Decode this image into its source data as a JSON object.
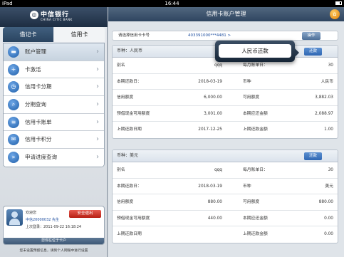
{
  "status": {
    "device": "iPad",
    "time": "16:44"
  },
  "brand": {
    "name_cn": "中信银行",
    "name_en": "CHINA CITIC BANK"
  },
  "tabs": [
    {
      "label": "借记卡"
    },
    {
      "label": "信用卡"
    }
  ],
  "menu": [
    {
      "label": "账户管理",
      "icon": "card-icon"
    },
    {
      "label": "卡激活",
      "icon": "activate-icon"
    },
    {
      "label": "信用卡分期",
      "icon": "clock-icon"
    },
    {
      "label": "分期查询",
      "icon": "search-icon"
    },
    {
      "label": "信用卡账单",
      "icon": "bill-icon"
    },
    {
      "label": "信用卡积分",
      "icon": "points-icon"
    },
    {
      "label": "申请进度查询",
      "icon": "progress-icon"
    }
  ],
  "user": {
    "welcome": "欢迎您",
    "name": "中信20000032 先生",
    "last_login": "上次登录：2011-09-22 16:18:24",
    "logout": "安全退出",
    "bar": "您现在位于卡户",
    "note": "您未设置预留信息，请到个人网银中进行设置"
  },
  "header": {
    "title": "信用卡账户管理"
  },
  "selector": {
    "label": "请选择信用卡卡号",
    "value": "403391000***4481 >",
    "op": "操作"
  },
  "popover": {
    "label": "人民币还款"
  },
  "sections": [
    {
      "currency": "币种：人民币",
      "pay": "还款",
      "rows": [
        {
          "l1": "别名",
          "v1": "qqq",
          "l2": "每月账单日：",
          "v2": "30"
        },
        {
          "l1": "本期还款日：",
          "v1": "2018-03-19",
          "l2": "币种",
          "v2": "人民币"
        },
        {
          "l1": "信用额度",
          "v1": "6,000.00",
          "l2": "可用额度",
          "v2": "3,882.03"
        },
        {
          "l1": "预借现金可用额度",
          "v1": "3,001.00",
          "l2": "本期应还金额",
          "v2": "2,088.97"
        },
        {
          "l1": "上期还款日期",
          "v1": "2017-12-25",
          "l2": "上期还款金额",
          "v2": "1.00"
        }
      ]
    },
    {
      "currency": "币种：美元",
      "pay": "还款",
      "rows": [
        {
          "l1": "别名",
          "v1": "qqq",
          "l2": "每月账单日：",
          "v2": "30"
        },
        {
          "l1": "本期还款日：",
          "v1": "2018-03-19",
          "l2": "币种",
          "v2": "美元"
        },
        {
          "l1": "信用额度",
          "v1": "880.00",
          "l2": "可用额度",
          "v2": "880.00"
        },
        {
          "l1": "预借现金可用额度",
          "v1": "440.00",
          "l2": "本期应还金额",
          "v2": "0.00"
        },
        {
          "l1": "上期还款日期",
          "v1": "",
          "l2": "上期还款金额",
          "v2": "0.00"
        }
      ]
    }
  ],
  "colors": {
    "nav": "#2f4560",
    "accent": "#2f67b3",
    "logout": "#b71f14",
    "home": "#e07b00"
  }
}
